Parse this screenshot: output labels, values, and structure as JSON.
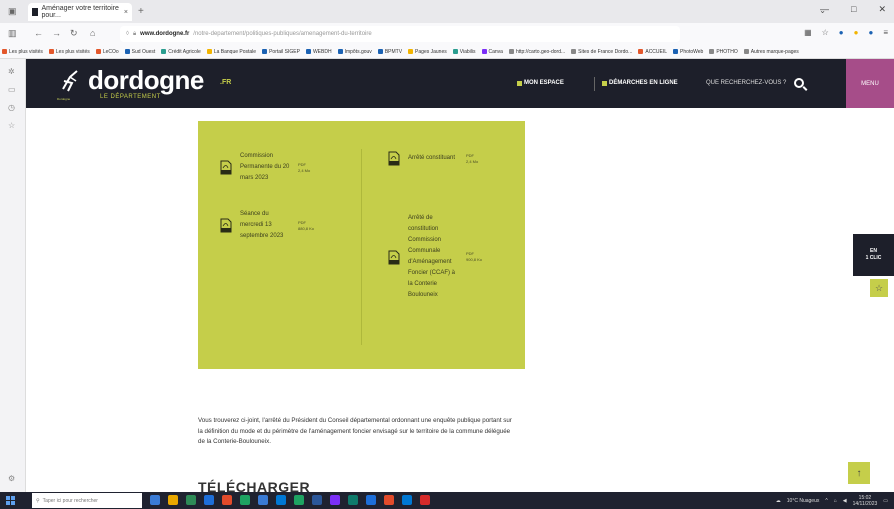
{
  "browser": {
    "tab_title": "Aménager votre territoire pour...",
    "tab_close": "×",
    "new_tab": "+",
    "url_host": "www.dordogne.fr",
    "url_rest": "/notre-departement/politiques-publiques/amenagement-du-territoire",
    "window_minimize": "—",
    "window_maximize": "□",
    "window_close": "✕"
  },
  "bookmarks": [
    {
      "label": "Les plus visités",
      "color": "#e3572b"
    },
    {
      "label": "Les plus visités",
      "color": "#e3572b"
    },
    {
      "label": "LeCOo",
      "color": "#e3572b"
    },
    {
      "label": "Sud Ouest",
      "color": "#1b62b3"
    },
    {
      "label": "Crédit Agricole",
      "color": "#2a9d8f"
    },
    {
      "label": "La Banque Postale",
      "color": "#f2b400"
    },
    {
      "label": "Portail SIGEP",
      "color": "#1b62b3"
    },
    {
      "label": "WEBDH",
      "color": "#1b62b3"
    },
    {
      "label": "Impôts.gouv",
      "color": "#1b62b3"
    },
    {
      "label": "BPMTV",
      "color": "#1b62b3"
    },
    {
      "label": "Pages Jaunes",
      "color": "#f2b400"
    },
    {
      "label": "Viabilis",
      "color": "#2a9d8f"
    },
    {
      "label": "Canva",
      "color": "#7b2ff7"
    },
    {
      "label": "http://carto.geo-dord...",
      "color": "#888888"
    },
    {
      "label": "Sites de France Dordo...",
      "color": "#888888"
    },
    {
      "label": "ACCUEIL",
      "color": "#e3572b"
    },
    {
      "label": "PhotoWeb",
      "color": "#1b62b3"
    },
    {
      "label": "PHOTHO",
      "color": "#888888"
    },
    {
      "label": "Autres marque-pages",
      "color": "#888888"
    }
  ],
  "header": {
    "logo_text": "dordogne",
    "logo_fr": ".FR",
    "logo_sub": "LE DÉPARTEMENT",
    "logo_caption": "Dordogne",
    "mon_espace": "MON ESPACE",
    "demarches": "DÉMARCHES EN LIGNE",
    "search_placeholder": "QUE RECHERCHEZ-VOUS ?",
    "menu": "MENU"
  },
  "documents": {
    "left": [
      {
        "title": "Commission Permanente du 20 mars 2023",
        "format": "PDF",
        "size": "2,4 Mo"
      },
      {
        "title": "Séance du mercredi 13 septembre 2023",
        "format": "PDF",
        "size": "880,8 Ko"
      }
    ],
    "right": [
      {
        "title": "Arrêté constituant",
        "format": "PDF",
        "size": "2,4 Mo"
      },
      {
        "title": "Arrêté de constitution Commission Communale d'Aménagement Foncier (CCAF) à la Conterie Boulouneix",
        "format": "PDF",
        "size": "900,8 Ko"
      }
    ]
  },
  "paragraph": "Vous trouverez ci-joint, l'arrêté du Président du Conseil départemental ordonnant une enquête publique portant sur la définition du mode et du périmètre de l'aménagement foncier envisagé sur le territoire de la commune déléguée de la Conterie-Boulouneix.",
  "telecharger": "TÉLÉCHARGER",
  "floating": {
    "en_un_clic_line1": "EN",
    "en_un_clic_line2": "1 CLIC",
    "star": "☆",
    "back_to_top": "↑"
  },
  "taskbar": {
    "search_placeholder": "Taper ici pour rechercher",
    "weather": "10°C Nuageux",
    "time": "15:02",
    "date": "14/11/2023"
  },
  "colors": {
    "header_bg": "#1d1f2a",
    "accent_green": "#c5ce4a",
    "menu_purple": "#a64d89"
  }
}
